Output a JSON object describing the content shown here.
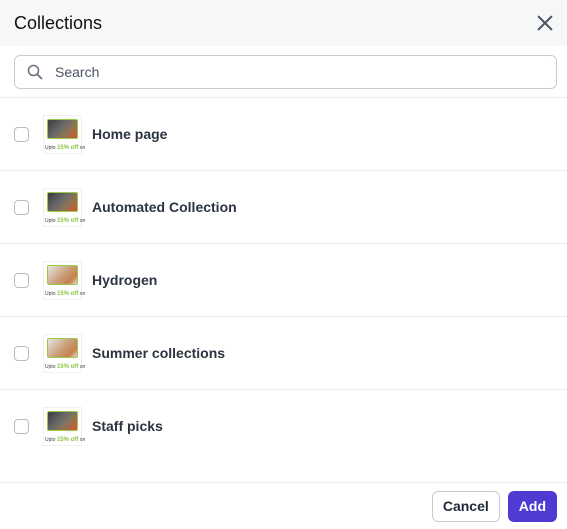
{
  "header": {
    "title": "Collections",
    "close_icon": "close-icon"
  },
  "search": {
    "placeholder": "Search",
    "value": "",
    "icon": "search-icon"
  },
  "collections": [
    {
      "label": "Home page",
      "checked": false,
      "thumbnail": "cat-food-promo-dark",
      "promo_prefix": "Upto",
      "promo_highlight": "15% off",
      "promo_suffix": "on"
    },
    {
      "label": "Automated Collection",
      "checked": false,
      "thumbnail": "cat-food-promo-dark",
      "promo_prefix": "Upto",
      "promo_highlight": "15% off",
      "promo_suffix": "on"
    },
    {
      "label": "Hydrogen",
      "checked": false,
      "thumbnail": "cat-grooming-promo-light",
      "promo_prefix": "Upto",
      "promo_highlight": "15% off",
      "promo_suffix": "on"
    },
    {
      "label": "Summer collections",
      "checked": false,
      "thumbnail": "cat-grooming-promo-light",
      "promo_prefix": "Upto",
      "promo_highlight": "15% off",
      "promo_suffix": "on"
    },
    {
      "label": "Staff picks",
      "checked": false,
      "thumbnail": "cat-food-promo-dark",
      "promo_prefix": "Upto",
      "promo_highlight": "15% off",
      "promo_suffix": "on"
    }
  ],
  "footer": {
    "cancel_label": "Cancel",
    "add_label": "Add"
  },
  "colors": {
    "primary": "#4f3bd1",
    "promo_green": "#8cc43f"
  }
}
